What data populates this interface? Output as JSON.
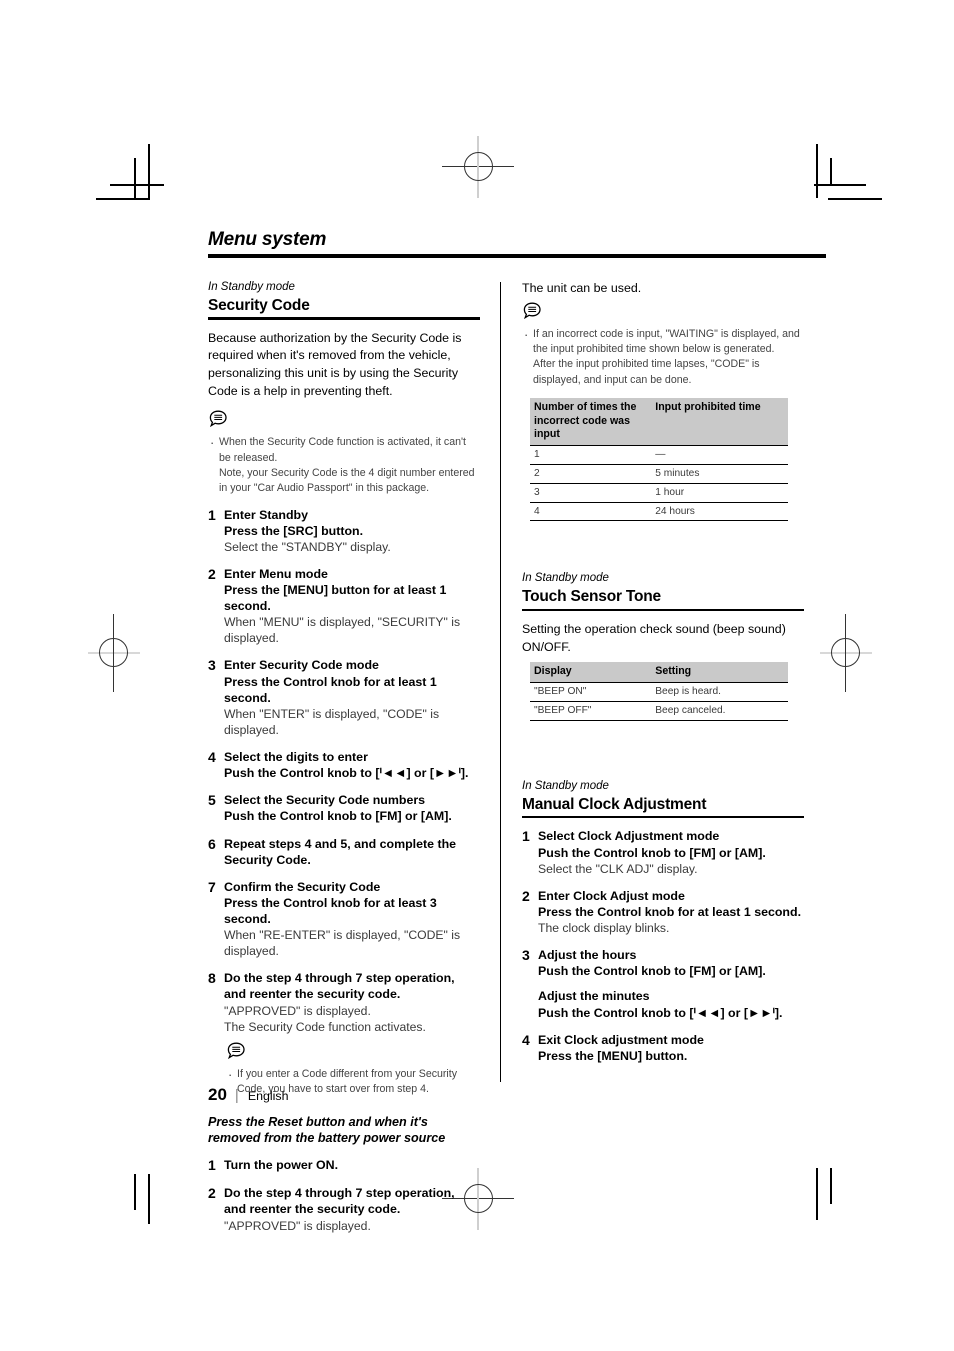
{
  "document": {
    "title": "Menu system",
    "page_number": "20",
    "separator": "|",
    "language": "English"
  },
  "left_column": {
    "eyebrow": "In Standby mode",
    "heading": "Security Code",
    "intro": "Because authorization by the Security Code is required when it's removed from the vehicle, personalizing this unit is by using the Security Code is a help in preventing theft.",
    "note_icon": "note-bubble-icon",
    "notes": [
      "When the Security Code function is activated, it can't be released.",
      "Note, your Security Code is the 4 digit number entered in your \"Car Audio Passport\" in this package."
    ],
    "steps": [
      {
        "num": "1",
        "title": "Enter Standby",
        "sub": "Press the [SRC] button.",
        "desc": "Select the \"STANDBY\" display."
      },
      {
        "num": "2",
        "title": "Enter Menu mode",
        "sub": "Press the [MENU] button for at least 1 second.",
        "desc": "When \"MENU\" is displayed, \"SECURITY\" is displayed."
      },
      {
        "num": "3",
        "title": "Enter Security Code mode",
        "sub": "Press the Control knob for at least 1 second.",
        "desc": "When \"ENTER\" is displayed, \"CODE\" is displayed."
      },
      {
        "num": "4",
        "title": "Select the digits to enter",
        "sub": "Push the Control knob to [ᑊ◄◄] or [►►ᑊ].",
        "desc": ""
      },
      {
        "num": "5",
        "title": "Select the Security Code numbers",
        "sub": "Push the Control knob to [FM] or [AM].",
        "desc": ""
      },
      {
        "num": "6",
        "title": "Repeat steps 4 and 5, and complete the Security Code.",
        "sub": "",
        "desc": ""
      },
      {
        "num": "7",
        "title": "Confirm the Security Code",
        "sub": "Press the Control knob for at least 3 second.",
        "desc": "When \"RE-ENTER\" is displayed, \"CODE\" is displayed."
      },
      {
        "num": "8",
        "title": "Do the step 4 through 7 step operation, and reenter the security code.",
        "sub": "",
        "desc": "\"APPROVED\" is displayed.",
        "desc2": "The Security Code function activates."
      }
    ],
    "step8_note": "If you enter a Code different from your Security Code, you have to start over from step 4.",
    "reset_lead": "Press the Reset button and when it's removed from the battery power source",
    "reset_steps": [
      {
        "num": "1",
        "title": "Turn the power ON.",
        "sub": "",
        "desc": ""
      },
      {
        "num": "2",
        "title": "Do the step 4 through 7 step operation, and reenter the security code.",
        "sub": "",
        "desc": "\"APPROVED\" is displayed."
      }
    ]
  },
  "right_column": {
    "lead": "The unit can be used.",
    "note_icon": "note-bubble-icon",
    "notes": [
      "If an incorrect code is input, \"WAITING\" is displayed, and the input prohibited time shown below is generated.",
      "After the input prohibited time lapses, \"CODE\" is displayed, and input can be done."
    ],
    "prohibit_table": {
      "headers": [
        "Number of times the incorrect code was input",
        "Input prohibited time"
      ],
      "rows": [
        [
          "1",
          "—"
        ],
        [
          "2",
          "5 minutes"
        ],
        [
          "3",
          "1 hour"
        ],
        [
          "4",
          "24 hours"
        ]
      ]
    },
    "touch_sensor": {
      "eyebrow": "In Standby mode",
      "heading": "Touch Sensor Tone",
      "intro": "Setting the operation check sound (beep sound) ON/OFF.",
      "table": {
        "headers": [
          "Display",
          "Setting"
        ],
        "rows": [
          [
            "\"BEEP ON\"",
            "Beep is heard."
          ],
          [
            "\"BEEP OFF\"",
            "Beep canceled."
          ]
        ]
      }
    },
    "clock": {
      "eyebrow": "In Standby mode",
      "heading": "Manual Clock Adjustment",
      "steps": [
        {
          "num": "1",
          "title": "Select Clock Adjustment mode",
          "sub": "Push the Control knob to [FM] or [AM].",
          "desc": "Select the \"CLK ADJ\" display."
        },
        {
          "num": "2",
          "title": "Enter Clock Adjust mode",
          "sub": "Press the Control knob for at least 1 second.",
          "desc": "The clock display blinks."
        },
        {
          "num": "3",
          "title": "Adjust the hours",
          "sub": "Push the Control knob to [FM] or [AM].",
          "sub2_title": "Adjust the minutes",
          "sub2": "Push the Control knob to [ᑊ◄◄] or [►►ᑊ].",
          "desc": ""
        },
        {
          "num": "4",
          "title": "Exit Clock adjustment mode",
          "sub": "Press the [MENU] button.",
          "desc": ""
        }
      ]
    }
  },
  "colors": {
    "table_header_bg": "#c9c9c9",
    "rule": "#000000",
    "body_text": "#000000",
    "note_text": "#444444"
  }
}
